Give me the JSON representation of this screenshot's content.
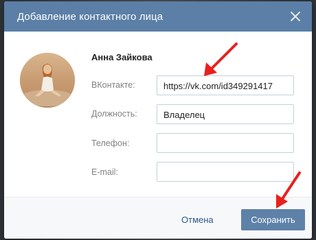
{
  "dialog": {
    "title": "Добавление контактного лица",
    "header_color": "#5b7fa6"
  },
  "contact": {
    "name": "Анна Зайкова"
  },
  "form": {
    "vk_label": "ВКонтакте:",
    "vk_value": "https://vk.com/id349291417",
    "position_label": "Должность:",
    "position_value": "Владелец",
    "phone_label": "Телефон:",
    "phone_value": "",
    "email_label": "E-mail:",
    "email_value": ""
  },
  "footer": {
    "cancel_label": "Отмена",
    "save_label": "Сохранить",
    "save_color": "#5e81a8"
  },
  "annotations": {
    "arrow_color": "#e8201f"
  },
  "icons": [
    "close-icon",
    "avatar",
    "annotation-arrow"
  ]
}
